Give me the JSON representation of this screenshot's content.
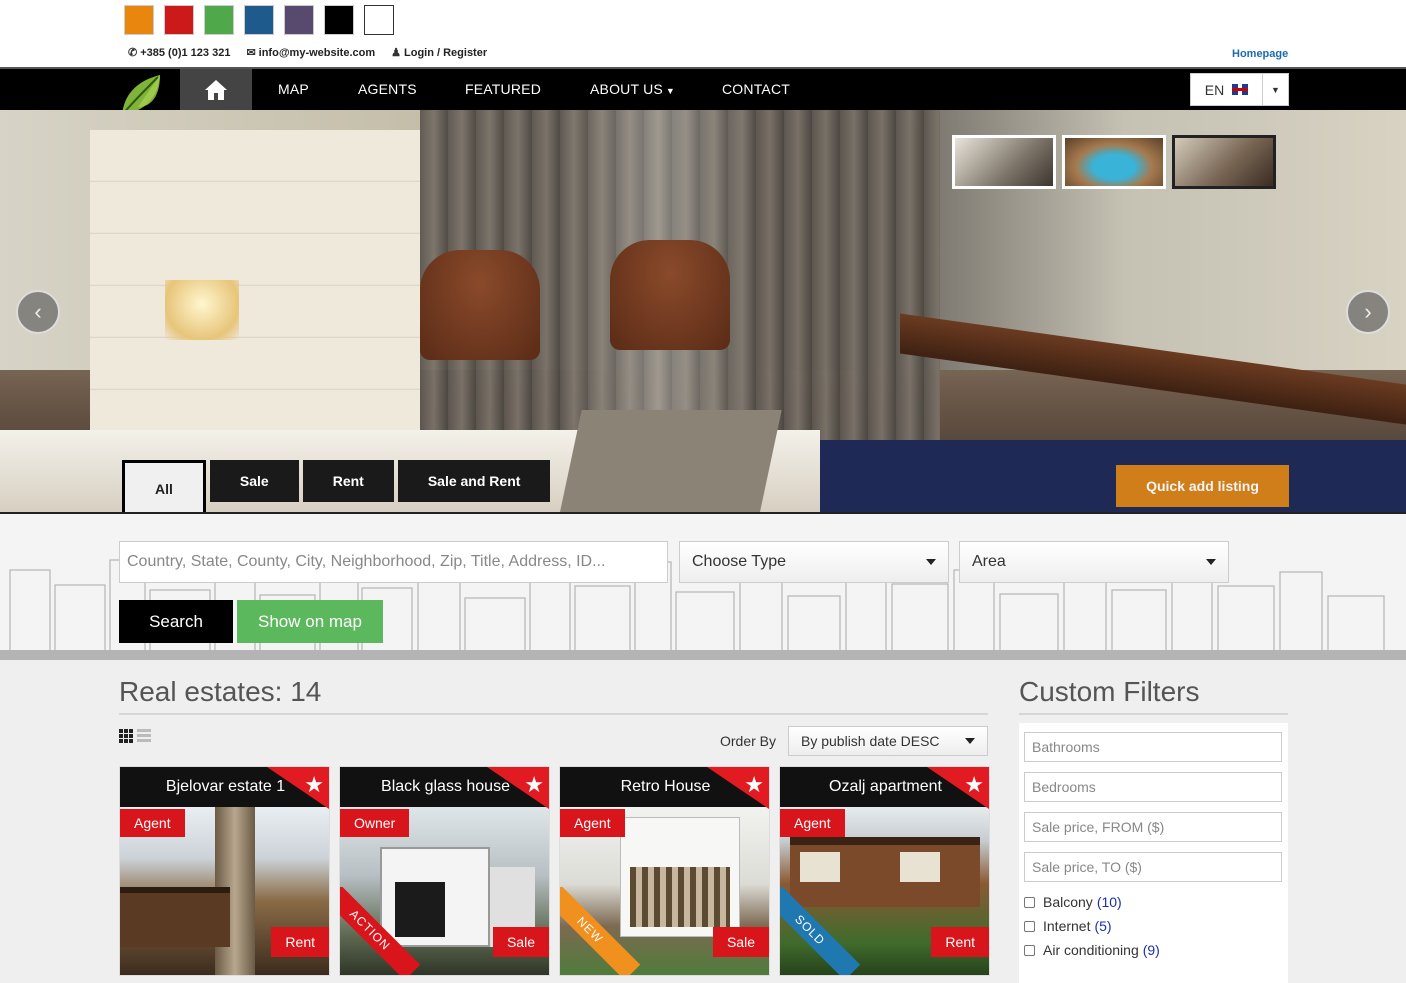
{
  "swatches": [
    "#e8860e",
    "#cc1a1a",
    "#4fa84a",
    "#1f5a8c",
    "#574a6e",
    "#000000",
    "#ffffff"
  ],
  "contact": {
    "phone": "+385 (0)1 123 321",
    "email": "info@my-website.com",
    "login": "Login / Register",
    "homepage": "Homepage"
  },
  "nav": {
    "items": [
      "MAP",
      "AGENTS",
      "FEATURED",
      "ABOUT US",
      "CONTACT"
    ],
    "language": "EN"
  },
  "search_tabs": [
    "All",
    "Sale",
    "Rent",
    "Sale and Rent"
  ],
  "quick_add": "Quick add listing",
  "search": {
    "placeholder": "Country, State, County, City, Neighborhood, Zip, Title, Address, ID...",
    "type_select": "Choose Type",
    "area_select": "Area",
    "search_button": "Search",
    "map_button": "Show on map"
  },
  "listings": {
    "title": "Real estates: 14",
    "order_label": "Order By",
    "order_value": "By publish date DESC",
    "cards": [
      {
        "title": "Bjelovar estate 1",
        "badge": "Agent",
        "purpose": "Rent",
        "ribbon": ""
      },
      {
        "title": "Black glass house",
        "badge": "Owner",
        "purpose": "Sale",
        "ribbon": "ACTION"
      },
      {
        "title": "Retro House",
        "badge": "Agent",
        "purpose": "Sale",
        "ribbon": "NEW"
      },
      {
        "title": "Ozalj apartment",
        "badge": "Agent",
        "purpose": "Rent",
        "ribbon": "SOLD"
      }
    ]
  },
  "filters": {
    "title": "Custom Filters",
    "inputs": [
      "Bathrooms",
      "Bedrooms",
      "Sale price, FROM ($)",
      "Sale price, TO ($)"
    ],
    "checks": [
      {
        "label": "Balcony",
        "count": "(10)"
      },
      {
        "label": "Internet",
        "count": "(5)"
      },
      {
        "label": "Air conditioning",
        "count": "(9)"
      }
    ]
  },
  "colors": {
    "accent_green": "#5cb85c",
    "accent_orange": "#d98316",
    "accent_red": "#d9151c",
    "nav_bg": "#000000"
  },
  "icons": {
    "phone": "phone-icon",
    "email": "envelope-icon",
    "user": "user-icon",
    "home": "home-icon",
    "star": "star-icon"
  }
}
